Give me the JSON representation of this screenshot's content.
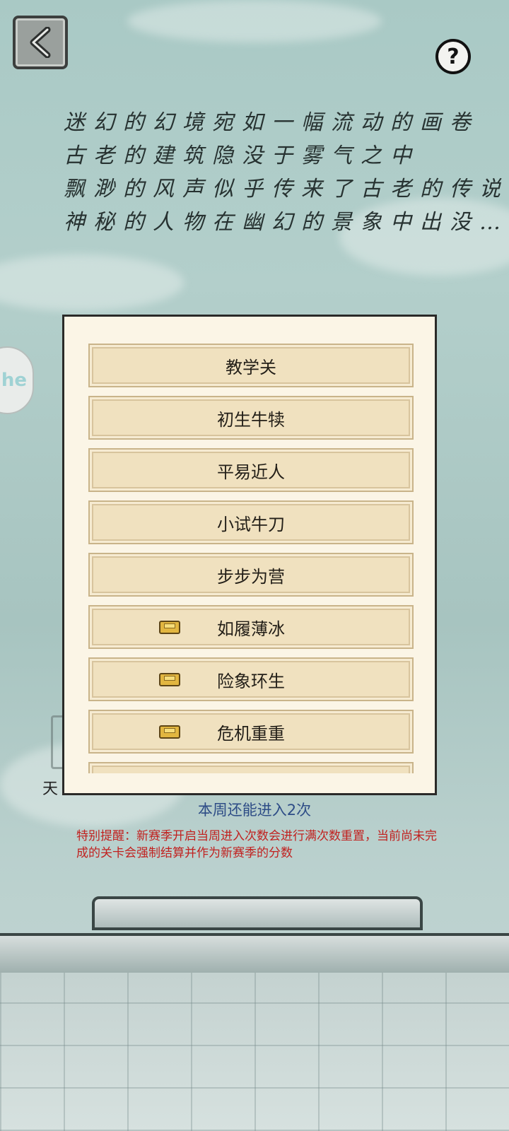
{
  "header": {
    "back_icon": "chevron-left-icon",
    "help_label": "?"
  },
  "poem": {
    "lines": [
      "迷幻的幻境宛如一幅流动的画卷",
      "古老的建筑隐没于雾气之中",
      "飘渺的风声似乎传来了古老的传说",
      "神秘的人物在幽幻的景象中出没…"
    ]
  },
  "side_icon": {
    "text": "he"
  },
  "background_label": "天",
  "level_list": {
    "items": [
      {
        "label": "教学关",
        "locked": false
      },
      {
        "label": "初生牛犊",
        "locked": false
      },
      {
        "label": "平易近人",
        "locked": false
      },
      {
        "label": "小试牛刀",
        "locked": false
      },
      {
        "label": "步步为营",
        "locked": false
      },
      {
        "label": "如履薄冰",
        "locked": true
      },
      {
        "label": "险象环生",
        "locked": true
      },
      {
        "label": "危机重重",
        "locked": true
      },
      {
        "label": "",
        "locked": false
      }
    ]
  },
  "remaining_entries": "本周还能进入2次",
  "notice": "特别提醒：新赛季开启当周进入次数会进行满次数重置，当前尚未完成的关卡会强制结算并作为新赛季的分数",
  "colors": {
    "notice": "#c1211f",
    "remaining": "#2d4c86",
    "button_fill": "#f0e1bf",
    "panel_fill": "#fbf5e6"
  }
}
